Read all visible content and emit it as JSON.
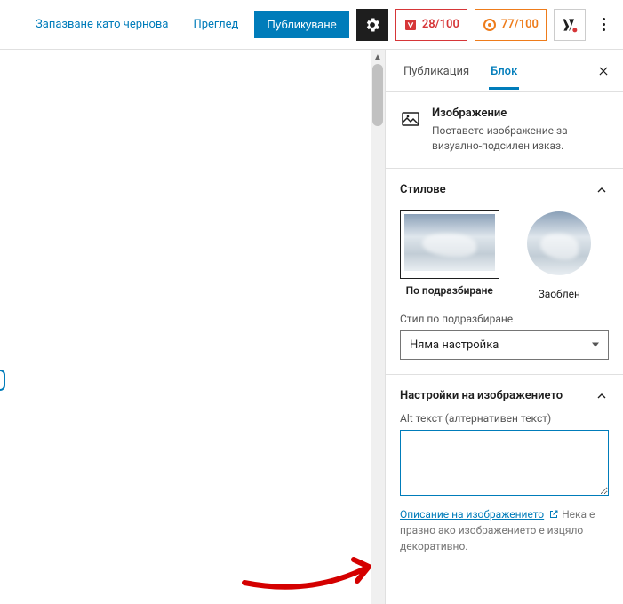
{
  "topbar": {
    "save_draft": "Запазване като чернова",
    "preview": "Преглед",
    "publish": "Публикуване",
    "score_seo": "28/100",
    "score_readability": "77/100"
  },
  "tabs": {
    "post": "Публикация",
    "block": "Блок"
  },
  "block_info": {
    "title": "Изображение",
    "description": "Поставете изображение за визуално-подсилен изказ."
  },
  "styles": {
    "heading": "Стилове",
    "default_label": "По подразбиране",
    "rounded_label": "Заоблен",
    "preview_caption": "",
    "default_style_label": "Стил по подразбиране",
    "default_style_value": "Няма настройка"
  },
  "image_settings": {
    "heading": "Настройки на изображението",
    "alt_label": "Alt текст (алтернативен текст)",
    "alt_value": "",
    "help_link": "Описание на изображението",
    "help_rest": "Нека е празно ако изображението е изцяло декоративно."
  }
}
